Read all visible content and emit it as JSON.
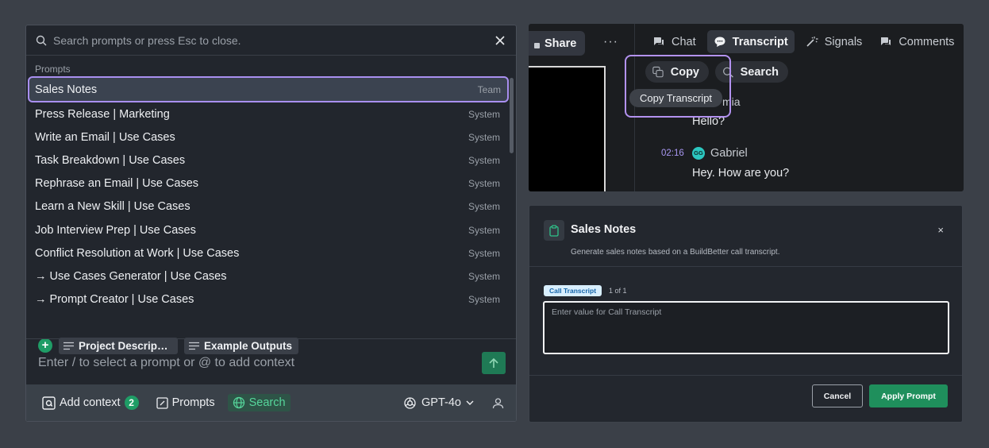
{
  "palette": {
    "search_placeholder": "Search prompts or press Esc to close.",
    "section_label": "Prompts",
    "items": [
      {
        "label": "Sales Notes",
        "tag": "Team"
      },
      {
        "label": "Press Release | Marketing",
        "tag": "System"
      },
      {
        "label": "Write an Email | Use Cases",
        "tag": "System"
      },
      {
        "label": "Task Breakdown | Use Cases",
        "tag": "System"
      },
      {
        "label": "Rephrase an Email | Use Cases",
        "tag": "System"
      },
      {
        "label": "Learn a New Skill | Use Cases",
        "tag": "System"
      },
      {
        "label": "Job Interview Prep | Use Cases",
        "tag": "System"
      },
      {
        "label": "Conflict Resolution at Work | Use Cases",
        "tag": "System"
      },
      {
        "label": "→ Use Cases Generator | Use Cases",
        "tag": "System"
      },
      {
        "label": "→ Prompt Creator | Use Cases",
        "tag": "System"
      }
    ],
    "context_chips": [
      "Project Descripti...",
      "Example Outputs"
    ],
    "compose_placeholder": "Enter / to select a prompt or @ to add context",
    "footer": {
      "add_context": "Add context",
      "context_count": "2",
      "prompts": "Prompts",
      "search": "Search",
      "model": "GPT-4o"
    }
  },
  "transcript_panel": {
    "share": "Share",
    "more": "···",
    "tabs": [
      "Chat",
      "Transcript",
      "Signals",
      "Comments"
    ],
    "active_tab": "Transcript",
    "copy": "Copy",
    "search": "Search",
    "tooltip": "Copy Transcript",
    "speaker_partial": "mia",
    "message1": "Hello?",
    "time": "02:16",
    "avatar_initials": "GG",
    "speaker": "Gabriel",
    "message2": "Hey. How are you?"
  },
  "dialog": {
    "title": "Sales Notes",
    "subtitle": "Generate sales notes based on a BuildBetter call transcript.",
    "close": "×",
    "field_label": "Call Transcript",
    "field_count": "1 of 1",
    "field_placeholder": "Enter value for Call Transcript",
    "cancel": "Cancel",
    "apply": "Apply Prompt"
  },
  "colors": {
    "accent_green": "#1f9d66",
    "highlight_purple": "#a98ff0"
  }
}
